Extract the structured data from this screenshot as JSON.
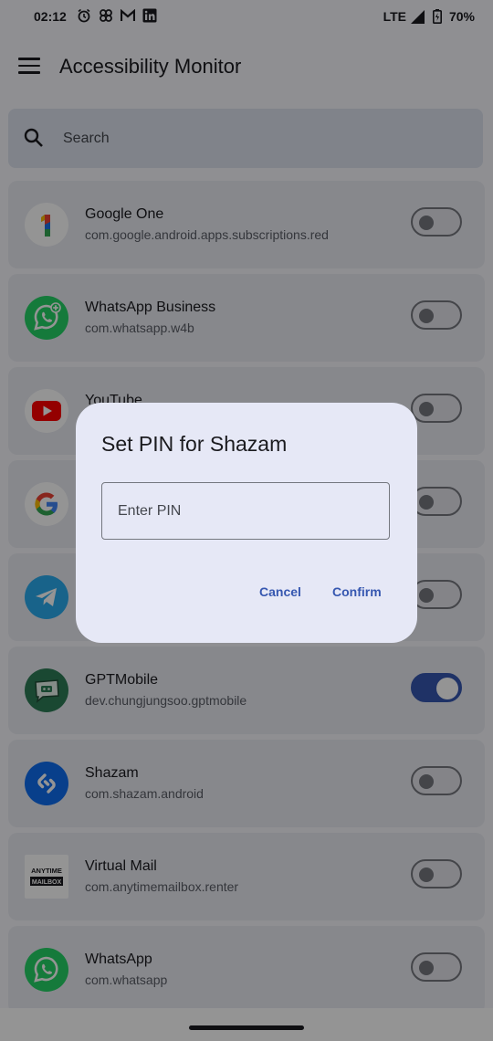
{
  "status_bar": {
    "time": "02:12",
    "network": "LTE",
    "battery": "70%"
  },
  "app_bar": {
    "title": "Accessibility Monitor"
  },
  "search": {
    "placeholder": "Search"
  },
  "apps": [
    {
      "name": "Google One",
      "package": "com.google.android.apps.subscriptions.red",
      "enabled": false,
      "icon": "google-one-icon"
    },
    {
      "name": "WhatsApp Business",
      "package": "com.whatsapp.w4b",
      "enabled": false,
      "icon": "whatsapp-business-icon"
    },
    {
      "name": "YouTube",
      "package": "",
      "enabled": false,
      "icon": "youtube-icon"
    },
    {
      "name": "",
      "package": "",
      "enabled": false,
      "icon": "google-icon"
    },
    {
      "name": "",
      "package": "",
      "enabled": false,
      "icon": "telegram-icon"
    },
    {
      "name": "GPTMobile",
      "package": "dev.chungjungsoo.gptmobile",
      "enabled": true,
      "icon": "gptmobile-icon"
    },
    {
      "name": "Shazam",
      "package": "com.shazam.android",
      "enabled": false,
      "icon": "shazam-icon"
    },
    {
      "name": "Virtual Mail",
      "package": "com.anytimemailbox.renter",
      "enabled": false,
      "icon": "anytime-mailbox-icon"
    },
    {
      "name": "WhatsApp",
      "package": "com.whatsapp",
      "enabled": false,
      "icon": "whatsapp-icon"
    }
  ],
  "dialog": {
    "title": "Set PIN for Shazam",
    "pin_placeholder": "Enter PIN",
    "cancel_label": "Cancel",
    "confirm_label": "Confirm"
  },
  "logo_text": {
    "anytime": "ANYTIME",
    "mailbox": "MAILBOX"
  },
  "colors": {
    "accent": "#3657b0",
    "dialog_background": "#e6e8f6",
    "card_background": "#e9ebf2"
  }
}
